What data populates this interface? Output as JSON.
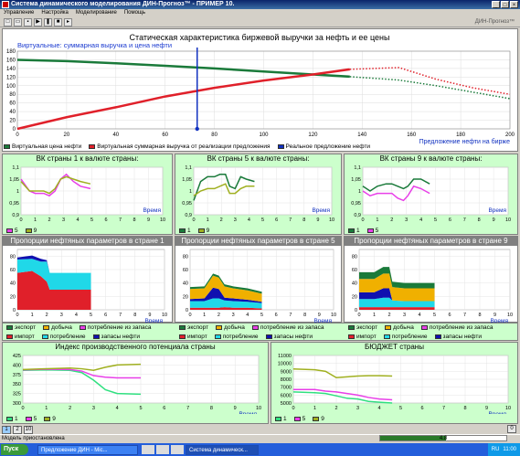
{
  "window": {
    "title": "Система динамического моделирования ДИН-Прогноз™ - ПРИМЕР 10.",
    "brand": "ДИН-Прогноз™"
  },
  "menu": [
    "Управление",
    "Настройка",
    "Моделирование",
    "Помощь"
  ],
  "toolbar": [
    "new-icon",
    "open-icon",
    "save-icon",
    "play-icon",
    "pause-icon",
    "stop-icon",
    "step-icon"
  ],
  "main": {
    "title": "Статическая характеристика биржевой выручки за нефть и ее цены",
    "subtitle": "Виртуальные: суммарная выручка и цена нефти",
    "xlabel": "Предложение нефти на бирже",
    "xticks": [
      "0",
      "20",
      "40",
      "60",
      "80",
      "100",
      "120",
      "140",
      "160",
      "180",
      "200"
    ],
    "yticks": [
      "0",
      "20",
      "40",
      "60",
      "80",
      "100",
      "120",
      "140",
      "160",
      "180"
    ],
    "legend": [
      {
        "label": "Виртуальная цена нефти",
        "color": "#1a7a3a"
      },
      {
        "label": "Виртуальная суммарная выручка от реализации предложения",
        "color": "#e0202a"
      },
      {
        "label": "Реальное предложение нефти",
        "color": "#1030c0"
      }
    ]
  },
  "vk": [
    {
      "title": "ВК страны 1 к валюте страны:",
      "legend": [
        {
          "label": "5",
          "color": "#e83fe8"
        },
        {
          "label": "9",
          "color": "#a0b020"
        }
      ]
    },
    {
      "title": "ВК страны 5 к валюте страны:",
      "legend": [
        {
          "label": "1",
          "color": "#1a7a3a"
        },
        {
          "label": "9",
          "color": "#a0b020"
        }
      ]
    },
    {
      "title": "ВК страны 9 к валюте страны:",
      "legend": [
        {
          "label": "1",
          "color": "#1a7a3a"
        },
        {
          "label": "5",
          "color": "#e83fe8"
        }
      ]
    }
  ],
  "vk_axis": {
    "yticks": [
      "0,9",
      "0,95",
      "1",
      "1,05",
      "1,1"
    ],
    "xticks": [
      "0",
      "1",
      "2",
      "3",
      "4",
      "5",
      "6",
      "7",
      "8",
      "9",
      "10"
    ],
    "xlabel": "Время"
  },
  "prop": [
    {
      "title": "Пропорции нефтяных параметров в стране 1",
      "yticks": [
        "0",
        "20",
        "40",
        "60",
        "80"
      ]
    },
    {
      "title": "Пропорции нефтяных параметров в стране 5",
      "yticks": [
        "0",
        "20",
        "40",
        "60",
        "80"
      ]
    },
    {
      "title": "Пропорции нефтяных параметров в стране 9",
      "yticks": [
        "0",
        "20",
        "40",
        "60",
        "80"
      ]
    }
  ],
  "prop_legend": [
    {
      "label": "экспорт",
      "color": "#1a7a3a"
    },
    {
      "label": "добыча",
      "color": "#f0b000"
    },
    {
      "label": "потребление из запаса",
      "color": "#e83fe8"
    },
    {
      "label": "импорт",
      "color": "#e0202a"
    },
    {
      "label": "потребление",
      "color": "#20d8e8"
    },
    {
      "label": "запасы нефти",
      "color": "#1010b0"
    }
  ],
  "ipp": {
    "title": "Индекс производственного потенциала страны",
    "yticks": [
      "300",
      "325",
      "350",
      "375",
      "400",
      "425"
    ],
    "legend": [
      {
        "label": "1",
        "color": "#30e080"
      },
      {
        "label": "5",
        "color": "#e83fe8"
      },
      {
        "label": "9",
        "color": "#a0b020"
      }
    ]
  },
  "budget": {
    "title": "БЮДЖЕТ страны",
    "yticks": [
      "5000",
      "6000",
      "7000",
      "8000",
      "9000",
      "10000",
      "11000"
    ],
    "legend": [
      {
        "label": "1",
        "color": "#30e080"
      },
      {
        "label": "5",
        "color": "#e83fe8"
      },
      {
        "label": "9",
        "color": "#a0b020"
      }
    ]
  },
  "bottom_tabs": [
    "1",
    "2",
    "10"
  ],
  "bottom_right": "0",
  "status": {
    "text": "Модель приостановлена",
    "progress_value": "4.8",
    "progress_fraction": 0.52
  },
  "taskbar": {
    "start": "Пуск",
    "tasks": [
      "Предложение ДИН - Mic...",
      "Система динамическ..."
    ],
    "lang": "RU",
    "clock": "11:00"
  }
}
